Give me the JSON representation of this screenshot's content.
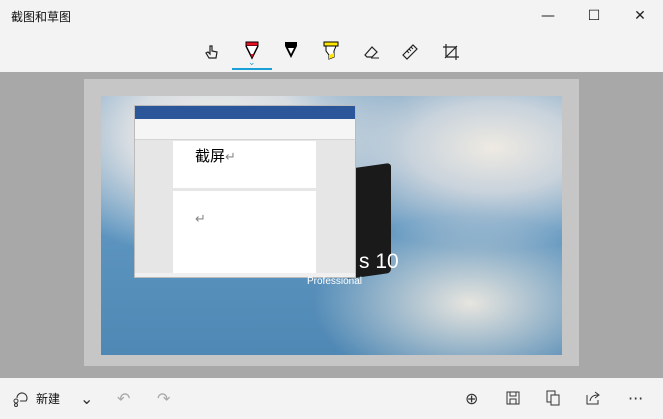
{
  "window": {
    "title": "截图和草图",
    "minimize": "—",
    "maximize": "☐",
    "close": "✕"
  },
  "toolbar": {
    "tools": [
      {
        "name": "touch-writing",
        "icon": "hand"
      },
      {
        "name": "ballpoint-pen",
        "icon": "pen",
        "color": "#e81123",
        "selected": true
      },
      {
        "name": "pencil",
        "icon": "pencil",
        "color": "#000000"
      },
      {
        "name": "highlighter",
        "icon": "highlighter",
        "color": "#ffe600"
      },
      {
        "name": "eraser",
        "icon": "eraser"
      },
      {
        "name": "ruler",
        "icon": "ruler"
      },
      {
        "name": "crop",
        "icon": "crop"
      }
    ],
    "accent": "#1a9fd6"
  },
  "screenshot": {
    "doc_text": "截屏",
    "return_mark": "↵",
    "logo_text": "s 10",
    "logo_sub": "Professional"
  },
  "bottom": {
    "new_label": "新建",
    "dropdown": "⌄",
    "undo": "↶",
    "redo": "↷",
    "zoom": "⊕",
    "save": "💾",
    "copy": "⧉",
    "share": "⇪",
    "more": "···"
  }
}
